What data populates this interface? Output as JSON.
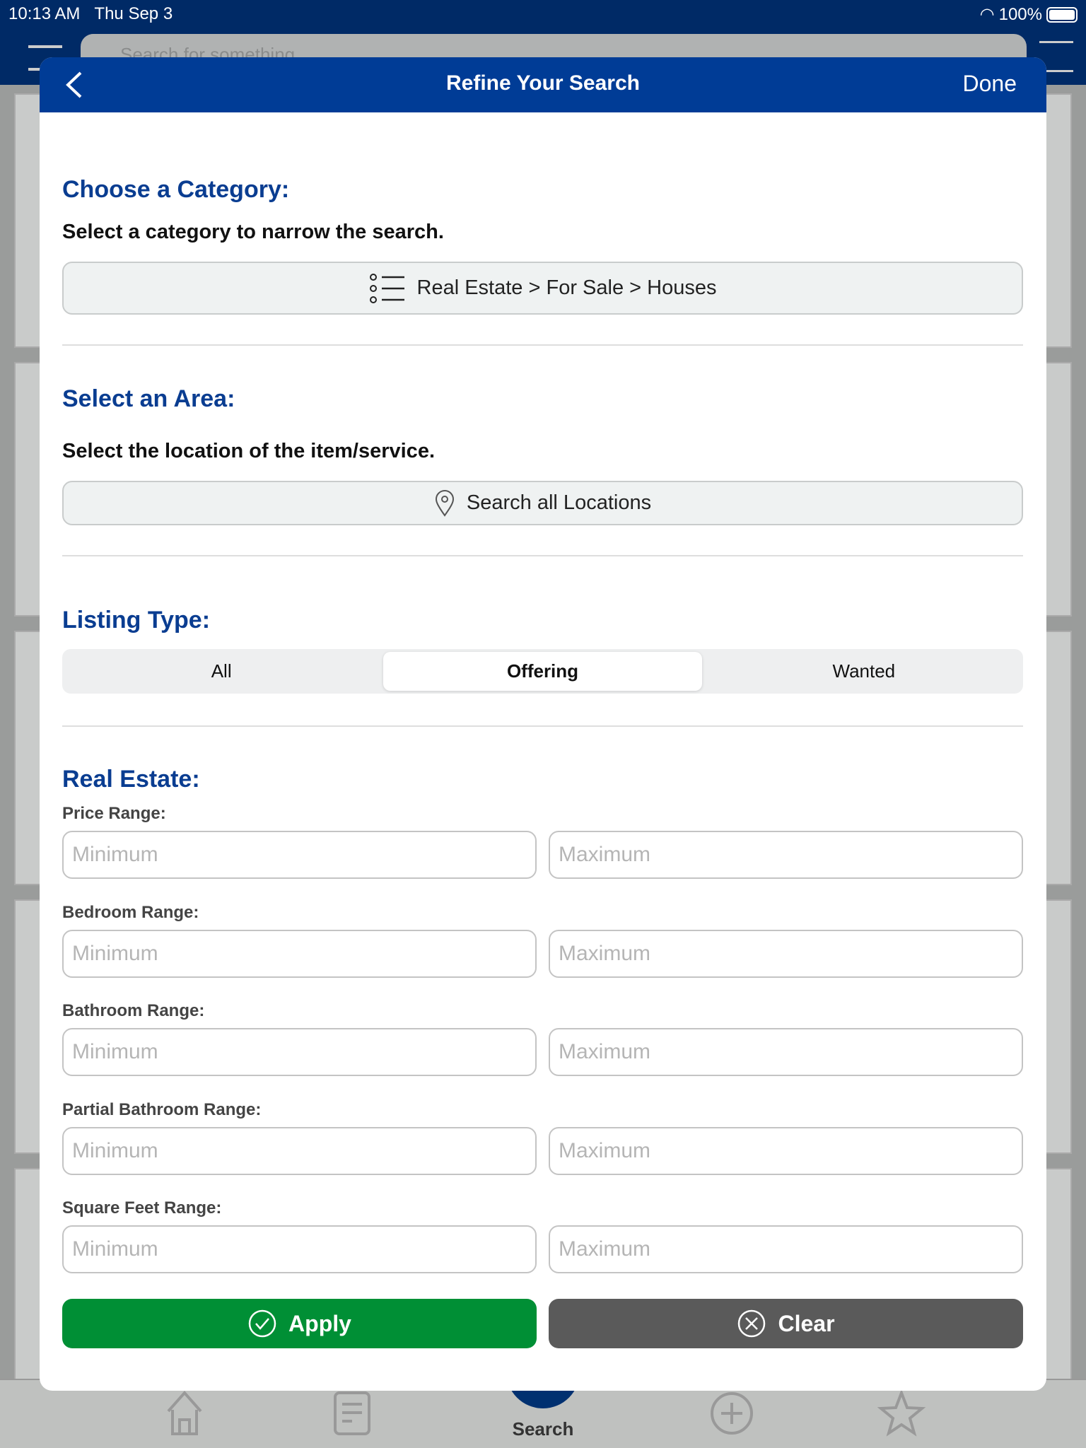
{
  "status": {
    "time": "10:13 AM",
    "date": "Thu Sep 3",
    "battery": "100%"
  },
  "background": {
    "search_placeholder": "Search for something",
    "tab_search_label": "Search"
  },
  "modal": {
    "title": "Refine Your Search",
    "done_label": "Done",
    "category": {
      "heading": "Choose a Category:",
      "subtitle": "Select a category to narrow the search.",
      "value": "Real Estate > For Sale > Houses",
      "icon": "list-icon"
    },
    "area": {
      "heading": "Select an Area:",
      "subtitle": "Select the location of the item/service.",
      "value": "Search all Locations",
      "icon": "location-pin-icon"
    },
    "listing_type": {
      "heading": "Listing Type:",
      "options": [
        "All",
        "Offering",
        "Wanted"
      ],
      "selected": "Offering"
    },
    "real_estate": {
      "heading": "Real Estate:",
      "ranges": [
        {
          "label": "Price Range:",
          "min_placeholder": "Minimum",
          "max_placeholder": "Maximum"
        },
        {
          "label": "Bedroom Range:",
          "min_placeholder": "Minimum",
          "max_placeholder": "Maximum"
        },
        {
          "label": "Bathroom Range:",
          "min_placeholder": "Minimum",
          "max_placeholder": "Maximum"
        },
        {
          "label": "Partial Bathroom Range:",
          "min_placeholder": "Minimum",
          "max_placeholder": "Maximum"
        },
        {
          "label": "Square Feet Range:",
          "min_placeholder": "Minimum",
          "max_placeholder": "Maximum"
        }
      ]
    },
    "apply_label": "Apply",
    "clear_label": "Clear"
  },
  "colors": {
    "header": "#003c96",
    "heading": "#0a3d91",
    "apply": "#008f35",
    "clear": "#5a5a5a"
  }
}
